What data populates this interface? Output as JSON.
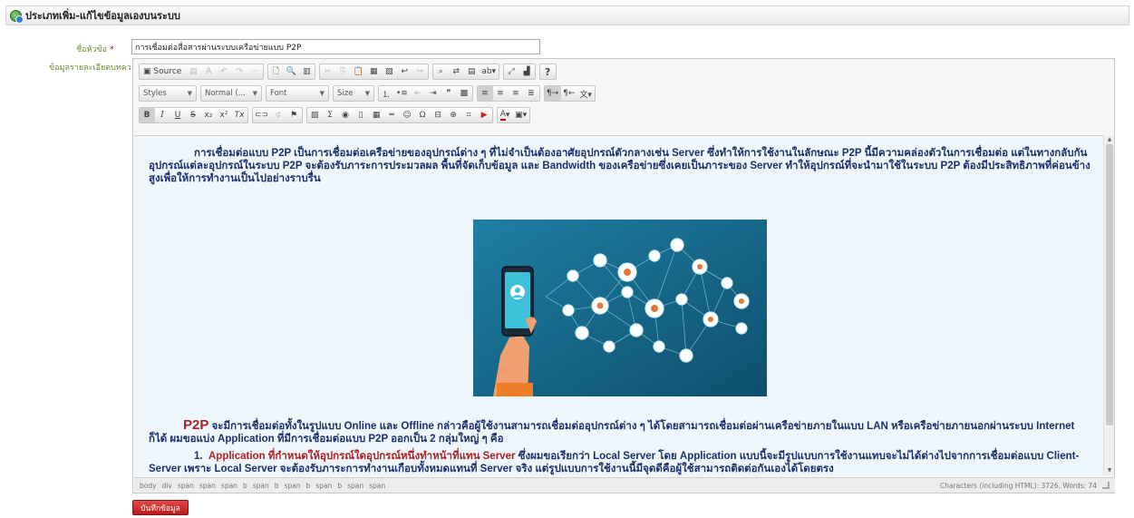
{
  "header": {
    "title": "ประเภทเพิ่ม-แก้ไขข้อมูลเองบนระบบ"
  },
  "form": {
    "title_label": "ชื่อหัวข้อ",
    "required_mark": "*",
    "title_value": "การเชื่อมต่อสื่อสารผ่านระบบเครือข่ายแบบ P2P",
    "detail_label": "ข้อมูลรายละเอียดบทความ"
  },
  "toolbar": {
    "source_label": "Source",
    "styles_label": "Styles",
    "format_label": "Normal (...",
    "font_label": "Font",
    "size_label": "Size",
    "help_label": "?"
  },
  "content": {
    "para1": "การเชื่อมต่อแบบ P2P เป็นการเชื่อมต่อเครือข่ายของอุปกรณ์ต่าง ๆ ที่ไม่จำเป็นต้องอาศัยอุปกรณ์ตัวกลางเช่น Server ซึ่งทำให้การใช้งานในลักษณะ P2P นี้มีความคล่องตัวในการเชื่อมต่อ แต่ในทางกลับกัน อุปกรณ์แต่ละอุปกรณ์ในระบบ P2P จะต้องรับภาระการประมวลผล พื้นที่จัดเก็บข้อมูล และ Bandwidth ของเครือข่ายซึ่งเคยเป็นภาระของ Server ทำให้อุปกรณ์ที่จะนำมาใช้ในระบบ P2P ต้องมีประสิทธิภาพที่ค่อนข้างสูงเพื่อให้การทำงานเป็นไปอย่างราบรื่น",
    "para2_lead": "P2P",
    "para2": " จะมีการเชื่อมต่อทั้งในรูปแบบ Online และ Offline กล่าวคือผู้ใช้งานสามารถเชื่อมต่ออุปกรณ์ต่าง ๆ ได้โดยสามารถเชื่อมต่อผ่านเครือข่ายภายในแบบ LAN หรือเครือข่ายภายนอกผ่านระบบ Internet ก็ได้ ผมขอแบ่ง Application ที่มีการเชื่อมต่อแบบ P2P ออกเป็น 2 กลุ่มใหญ่ ๆ คือ",
    "item1_num": "1.",
    "item1_red": "Application ที่กำหนดให้อุปกรณ์ใดอุปกรณ์หนึ่งทำหน้าที่แทน Server",
    "item1_rest": " ซึ่งผมขอเรียกว่า Local Server โดย Application แบบนี้จะมีรูปแบบการใช้งานแทบจะไม่ได้ต่างไปจากการเชื่อมต่อแบบ Client-Server เพราะ Local Server จะต้องรับภาระการทำงานเกือบทั้งหมดแทนที่ Server จริง แต่รูปแบบการใช้งานนี้มีจุดดีคือผู้ใช้สามารถติดต่อกันเองได้โดยตรง"
  },
  "statusbar": {
    "path": [
      "body",
      "div",
      "span",
      "span",
      "span",
      "b",
      "span",
      "b",
      "span",
      "b",
      "span",
      "b",
      "span",
      "span"
    ],
    "counter": "Characters (including HTML): 3726, Words: 74"
  },
  "save_button": "บันทึกข้อมูล",
  "colors": {
    "accent": "#b71c1c",
    "text_blue": "#1b2f6b",
    "label_green": "#6a8c2e"
  },
  "icons": [
    "globe-edit-icon",
    "source-icon",
    "bold-icon",
    "italic-icon",
    "underline-icon",
    "strike-icon",
    "image-icon",
    "table-icon",
    "link-icon",
    "maximize-icon"
  ]
}
